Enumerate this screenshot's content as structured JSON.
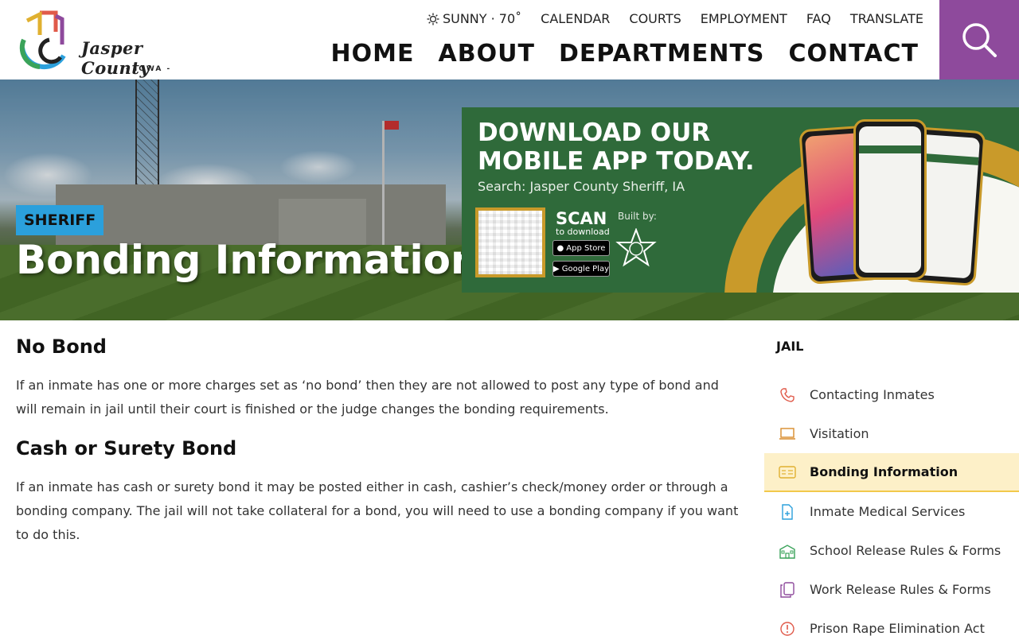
{
  "header": {
    "logo": {
      "text": "Jasper County",
      "sub": "- IOWA -"
    },
    "weather": {
      "condition": "SUNNY",
      "temp": "70˚",
      "label": "SUNNY · 70˚"
    },
    "utility_nav": [
      "CALENDAR",
      "COURTS",
      "EMPLOYMENT",
      "FAQ",
      "TRANSLATE"
    ],
    "main_nav": [
      "HOME",
      "ABOUT",
      "DEPARTMENTS",
      "CONTACT"
    ],
    "search_color": "#8e4a9c"
  },
  "hero": {
    "category": "SHERIFF",
    "title": "Bonding Information",
    "banner": {
      "title_line1": "DOWNLOAD OUR",
      "title_line2": "MOBILE APP TODAY.",
      "search": "Search: Jasper County Sheriff, IA",
      "scan": "SCAN",
      "scan_sub": "to download",
      "app_store": "App Store",
      "google_play": "Google Play",
      "built_by": "Built by:"
    }
  },
  "content": {
    "sections": [
      {
        "heading": "No Bond",
        "text": "If an inmate has one or more charges set as ‘no bond’ then they are not allowed to post any type of bond and will remain in jail until their court is finished or the judge changes the bonding requirements."
      },
      {
        "heading": "Cash or Surety Bond",
        "text": "If an inmate has cash or surety bond it may be posted either in cash, cashier’s check/money order or through a bonding company. The jail will not take collateral for a bond, you will need to use a bonding company if you want to do this."
      }
    ]
  },
  "sidebar": {
    "heading": "JAIL",
    "items": [
      {
        "label": "Contacting Inmates",
        "icon": "phone-icon",
        "color": "#e05a4a"
      },
      {
        "label": "Visitation",
        "icon": "laptop-icon",
        "color": "#d98b2b"
      },
      {
        "label": "Bonding Information",
        "icon": "id-card-icon",
        "color": "#e0b030",
        "active": true
      },
      {
        "label": "Inmate Medical Services",
        "icon": "medical-file-icon",
        "color": "#2ba0dc"
      },
      {
        "label": "School Release Rules & Forms",
        "icon": "school-icon",
        "color": "#3aa35a"
      },
      {
        "label": "Work Release Rules & Forms",
        "icon": "documents-icon",
        "color": "#8e4a9c"
      },
      {
        "label": "Prison Rape Elimination Act",
        "icon": "info-icon",
        "color": "#e05a4a"
      }
    ]
  }
}
